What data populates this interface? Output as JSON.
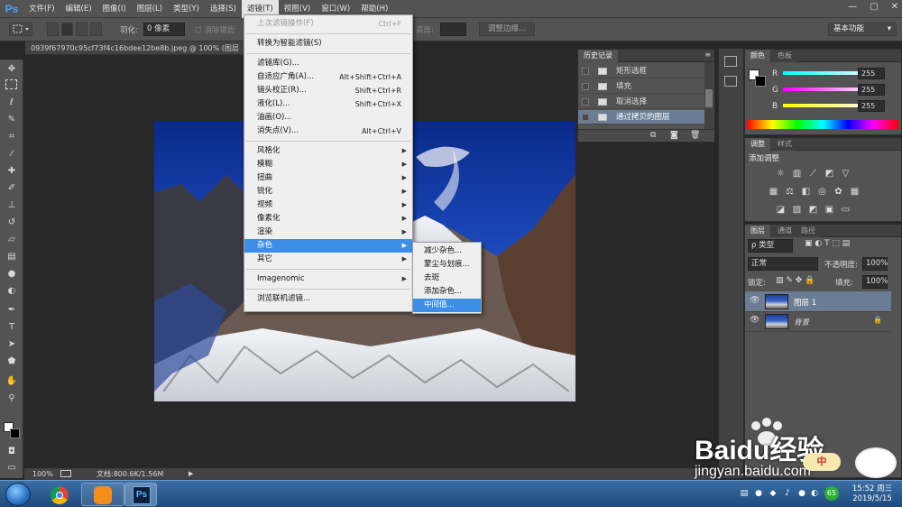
{
  "app": {
    "logo": "Ps"
  },
  "menubar": {
    "items": [
      "文件(F)",
      "编辑(E)",
      "图像(I)",
      "图层(L)",
      "类型(Y)",
      "选择(S)",
      "滤镜(T)",
      "视图(V)",
      "窗口(W)",
      "帮助(H)"
    ],
    "active_index": 6
  },
  "optbar": {
    "feather_label": "羽化:",
    "feather_value": "0 像素",
    "antialias_label": "消除锯齿",
    "height_label": "高度:",
    "refine_button": "调整边缘...",
    "workspace": "基本功能"
  },
  "document": {
    "tab_title": "0939f67970c95cf73f4c16bdee12be8b.jpeg @ 100% (图层",
    "zoom": "100%",
    "doc_info": "文档:800.6K/1.56M"
  },
  "filter_menu": {
    "items": [
      {
        "label": "上次滤镜操作(F)",
        "shortcut": "Ctrl+F",
        "disabled": true
      },
      {
        "sep": true
      },
      {
        "label": "转换为智能滤镜(S)"
      },
      {
        "sep": true
      },
      {
        "label": "滤镜库(G)..."
      },
      {
        "label": "自适应广角(A)...",
        "shortcut": "Alt+Shift+Ctrl+A"
      },
      {
        "label": "镜头校正(R)...",
        "shortcut": "Shift+Ctrl+R"
      },
      {
        "label": "液化(L)...",
        "shortcut": "Shift+Ctrl+X"
      },
      {
        "label": "油画(O)..."
      },
      {
        "label": "消失点(V)...",
        "shortcut": "Alt+Ctrl+V"
      },
      {
        "sep": true
      },
      {
        "label": "风格化",
        "submenu": true
      },
      {
        "label": "模糊",
        "submenu": true
      },
      {
        "label": "扭曲",
        "submenu": true
      },
      {
        "label": "锐化",
        "submenu": true
      },
      {
        "label": "视频",
        "submenu": true
      },
      {
        "label": "像素化",
        "submenu": true
      },
      {
        "label": "渲染",
        "submenu": true
      },
      {
        "label": "杂色",
        "submenu": true,
        "highlight": true
      },
      {
        "label": "其它",
        "submenu": true
      },
      {
        "sep": true
      },
      {
        "label": "Imagenomic",
        "submenu": true
      },
      {
        "sep": true
      },
      {
        "label": "浏览联机滤镜..."
      }
    ]
  },
  "noise_menu": {
    "items": [
      {
        "label": "减少杂色..."
      },
      {
        "label": "蒙尘与划痕..."
      },
      {
        "label": "去斑"
      },
      {
        "label": "添加杂色..."
      },
      {
        "label": "中间值...",
        "highlight": true
      }
    ]
  },
  "history": {
    "tab": "历史记录",
    "rows": [
      {
        "label": "矩形选框"
      },
      {
        "label": "填充"
      },
      {
        "label": "取消选择"
      },
      {
        "label": "通过拷贝的图层",
        "selected": true
      }
    ]
  },
  "color_panel": {
    "tabs": [
      "颜色",
      "色板"
    ],
    "r_label": "R",
    "g_label": "G",
    "b_label": "B",
    "r": "255",
    "g": "255",
    "b": "255"
  },
  "adjust_panel": {
    "tabs": [
      "调整",
      "样式"
    ],
    "title": "添加调整"
  },
  "layers_panel": {
    "tabs": [
      "图层",
      "通道",
      "路径"
    ],
    "filter_kind": "ρ 类型",
    "blend_mode": "正常",
    "opacity_label": "不透明度:",
    "opacity": "100%",
    "lock_label": "锁定:",
    "fill_label": "填充:",
    "fill": "100%",
    "layers": [
      {
        "name": "图层 1",
        "selected": true
      },
      {
        "name": "背景",
        "locked": true
      }
    ]
  },
  "taskbar": {
    "time": "15:52 周三",
    "date": "2019/5/15",
    "tray_badge": "65"
  },
  "watermark": {
    "brand": "Baidu经验",
    "url": "jingyan.baidu.com",
    "lang": "中"
  },
  "colors": {
    "ui_panel": "#535353",
    "menu_highlight": "#3c8ee8",
    "history_selected": "#6b7d94"
  }
}
